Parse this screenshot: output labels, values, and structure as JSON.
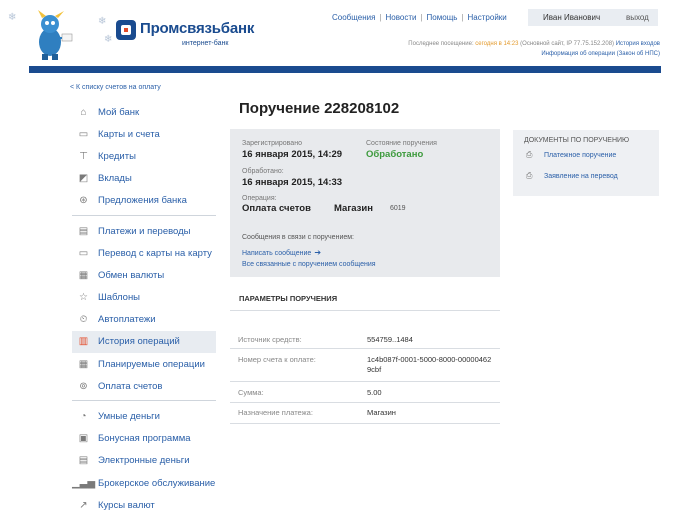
{
  "header": {
    "logo_name": "Промсвязьбанк",
    "logo_sub": "интернет-банк",
    "nav": [
      "Сообщения",
      "Новости",
      "Помощь",
      "Настройки"
    ],
    "username": "Иван Иванович",
    "logout": "выход",
    "last_visit_label": "Последнее посещение:",
    "last_visit_value": "сегодня в 14:23",
    "last_visit_detail": "(Основной сайт, IP 77.75.152.208)",
    "login_history": "История входов",
    "info_link": "Информация об операции (Закон об НПС)"
  },
  "sidebar": {
    "back_link": "< К списку счетов на оплату",
    "groups": [
      [
        {
          "label": "Мой банк",
          "icon": "home-icon"
        },
        {
          "label": "Карты и счета",
          "icon": "cards-icon"
        },
        {
          "label": "Кредиты",
          "icon": "credit-icon"
        },
        {
          "label": "Вклады",
          "icon": "deposit-icon"
        },
        {
          "label": "Предложения банка",
          "icon": "offers-icon"
        }
      ],
      [
        {
          "label": "Платежи и переводы",
          "icon": "payments-icon"
        },
        {
          "label": "Перевод с карты на карту",
          "icon": "card-transfer-icon"
        },
        {
          "label": "Обмен валюты",
          "icon": "exchange-icon"
        },
        {
          "label": "Шаблоны",
          "icon": "star-icon"
        },
        {
          "label": "Автоплатежи",
          "icon": "autopay-icon"
        },
        {
          "label": "История операций",
          "icon": "history-icon",
          "active": true
        },
        {
          "label": "Планируемые операции",
          "icon": "planned-icon"
        },
        {
          "label": "Оплата счетов",
          "icon": "bills-icon"
        }
      ],
      [
        {
          "label": "Умные деньги",
          "icon": "smart-money-icon"
        },
        {
          "label": "Бонусная программа",
          "icon": "bonus-icon"
        },
        {
          "label": "Электронные деньги",
          "icon": "emoney-icon"
        },
        {
          "label": "Брокерское обслуживание",
          "icon": "broker-icon"
        },
        {
          "label": "Курсы валют",
          "icon": "rates-icon"
        }
      ]
    ]
  },
  "order": {
    "title": "Поручение 228208102",
    "registered_label": "Зарегистрировано",
    "registered_value": "16 января 2015, 14:29",
    "status_label": "Состояние поручения",
    "status_value": "Обработано",
    "processed_label": "Обработано:",
    "processed_value": "16 января 2015, 14:33",
    "operation_label": "Операция:",
    "operation_value": "Оплата счетов",
    "operation_merchant": "Магазин",
    "operation_code": "6019",
    "messages_title": "Сообщения в связи с поручением:",
    "write_message": "Написать сообщение",
    "all_messages": "Все связанные с поручением сообщения"
  },
  "documents": {
    "title": "ДОКУМЕНТЫ ПО ПОРУЧЕНИЮ",
    "items": [
      "Платежное поручение",
      "Заявление на перевод"
    ]
  },
  "params": {
    "title": "ПАРАМЕТРЫ ПОРУЧЕНИЯ",
    "rows": [
      {
        "label": "Источник средств:",
        "value": "554759..1484"
      },
      {
        "label": "Номер счета к оплате:",
        "value": "1c4b087f-0001-5000-8000-000004629cbf"
      },
      {
        "label": "Сумма:",
        "value": "5.00"
      },
      {
        "label": "Назначение платежа:",
        "value": "Магазин"
      }
    ]
  },
  "colors": {
    "brand_blue": "#1a4b8f",
    "link_blue": "#2a5fa8",
    "status_green": "#3c9a3c",
    "highlight_orange": "#e39a2c"
  }
}
